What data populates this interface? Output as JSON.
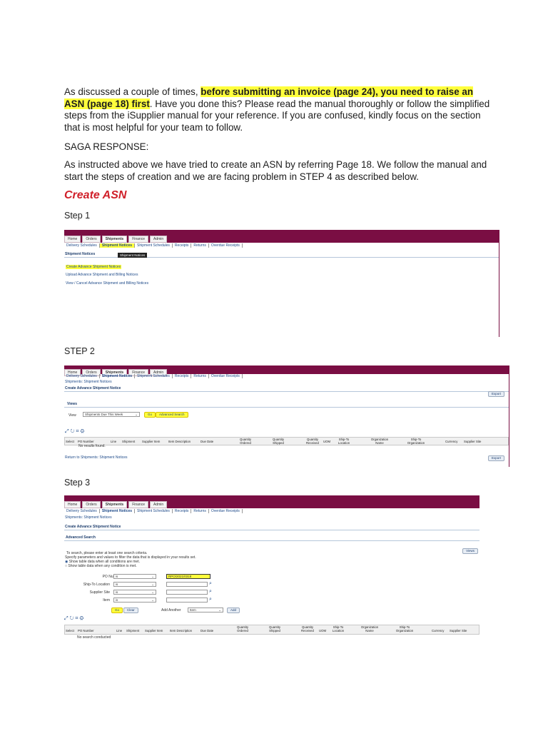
{
  "intro": {
    "p1_pre": "As discussed a couple of times, ",
    "p1_highlight": "before submitting an invoice (page 24), you need to raise an ASN (page 18) first",
    "p1_post": ". Have you done this? Please read the manual thoroughly or follow the simplified steps from the iSupplier manual for your reference. If you are confused, kindly focus on the section that is most helpful for your team to follow.",
    "saga_heading": "SAGA RESPONSE:",
    "p2": "As instructed above we have tried to create an ASN by referring Page 18. We follow the manual and start the steps of creation and we are facing problem in STEP 4 as described below."
  },
  "section_title": "Create ASN",
  "step_labels": [
    "Step 1",
    "STEP 2",
    "Step 3"
  ],
  "tabs": [
    "Home",
    "Orders",
    "Shipments",
    "Finance",
    "Admin"
  ],
  "subnav": [
    "Delivery Schedules",
    "Shipment Notices",
    "Shipment Schedules",
    "Receipts",
    "Returns",
    "Overdue Receipts"
  ],
  "step1": {
    "heading": "Shipment Notices",
    "tooltip": "Shipment Notices",
    "links": [
      "Create Advance Shipment Notices",
      "Upload Advance Shipment and Billing Notices",
      "View / Cancel Advance Shipment and Billing Notices"
    ]
  },
  "step2": {
    "breadcrumb": "Shipments: Shipment Notices",
    "page_title": "Create Advance Shipment Notice",
    "export": "Export",
    "views_title": "Views",
    "view_label": "View",
    "view_value": "Shipments Due This Week",
    "go": "Go",
    "advanced_search": "Advanced Search",
    "columns": [
      "Select",
      "PO Number",
      "Line",
      "Shipment",
      "Supplier Item",
      "Item Description",
      "Due Date",
      "Quantity Ordered",
      "Quantity Shipped",
      "Quantity Received",
      "UOM",
      "Ship-To Location",
      "Organization Name",
      "Ship-To Organization",
      "Currency",
      "Supplier Site"
    ],
    "no_results": "No results found.",
    "return_link": "Return to Shipments: Shipment Notices",
    "export_bottom": "Export"
  },
  "step3": {
    "breadcrumb": "Shipments: Shipment Notices",
    "page_title": "Create Advance Shipment Notice",
    "adv_title": "Advanced Search",
    "views_btn": "Views",
    "hint1": "To search, please enter at least one search criteria.",
    "hint2": "Specify parameters and values to filter the data that is displayed in your results set.",
    "radio1": "Show table data when all conditions are met.",
    "radio2": "Show table data when any condition is met.",
    "fields": [
      {
        "label": "PO Number",
        "op": "is",
        "value": "RPO/2021/0318"
      },
      {
        "label": "Ship-To Location",
        "op": "is",
        "value": ""
      },
      {
        "label": "Supplier Site",
        "op": "is",
        "value": ""
      },
      {
        "label": "Item",
        "op": "is",
        "value": ""
      }
    ],
    "go": "Go",
    "clear": "Clear",
    "add_another": "Add Another",
    "add_select": "Item",
    "add": "Add",
    "columns": [
      "Select",
      "PO Number",
      "Line",
      "Shipment",
      "Supplier Item",
      "Item Description",
      "Due Date",
      "Quantity Ordered",
      "Quantity Shipped",
      "Quantity Received",
      "UOM",
      "Ship-To Location",
      "Organization Name",
      "Ship-To Organization",
      "Currency",
      "Supplier Site"
    ],
    "no_search": "No search conducted"
  },
  "icons": {
    "table_tools": [
      "expand-icon",
      "refresh-icon",
      "filter-icon",
      "settings-icon"
    ],
    "search": "magnifier-icon"
  },
  "colors": {
    "brand_band": "#7a0e43",
    "highlight": "#ffff3c",
    "section_title": "#d0202a",
    "link": "#1f4b8a"
  }
}
